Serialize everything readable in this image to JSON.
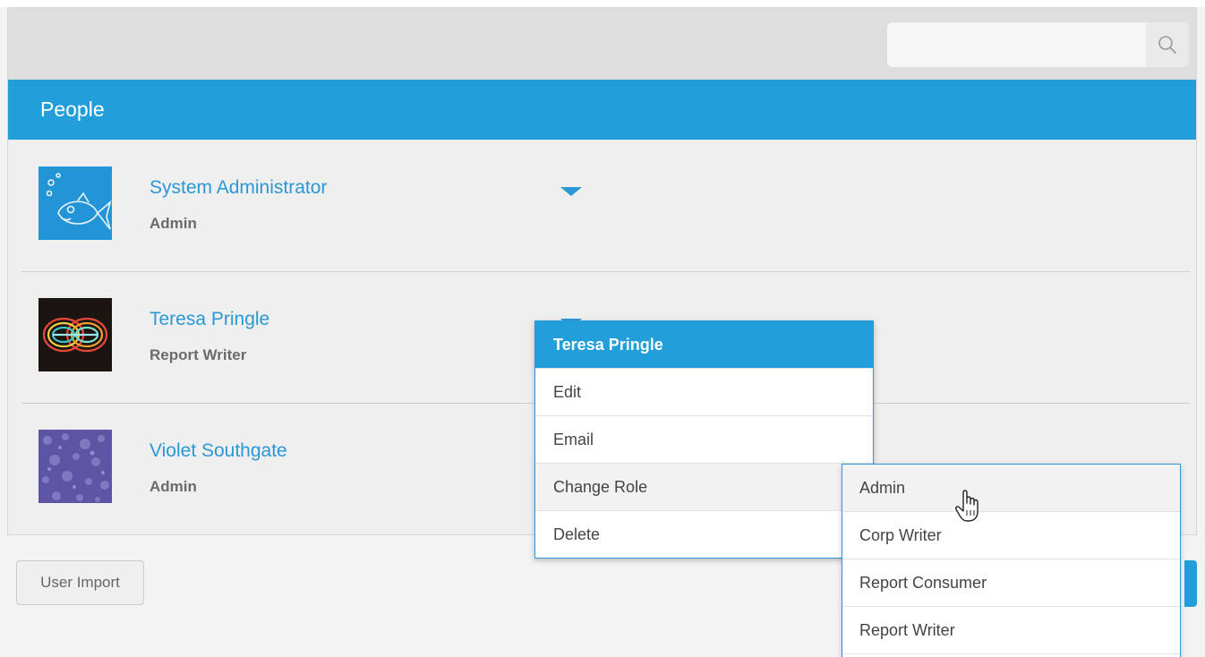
{
  "search": {
    "placeholder": "",
    "value": "",
    "icon": "search-icon"
  },
  "header": {
    "title": "People"
  },
  "people": [
    {
      "name": "System Administrator",
      "role": "Admin"
    },
    {
      "name": "Teresa Pringle",
      "role": "Report Writer"
    },
    {
      "name": "Violet Southgate",
      "role": "Admin"
    }
  ],
  "footer": {
    "user_import_label": "User Import"
  },
  "context_menu": {
    "title": "Teresa Pringle",
    "items": [
      "Edit",
      "Email",
      "Change Role",
      "Delete"
    ]
  },
  "role_submenu": {
    "items": [
      "Admin",
      "Corp Writer",
      "Report Consumer",
      "Report Writer"
    ]
  },
  "colors": {
    "accent": "#229fdb",
    "link": "#2a98d6"
  }
}
